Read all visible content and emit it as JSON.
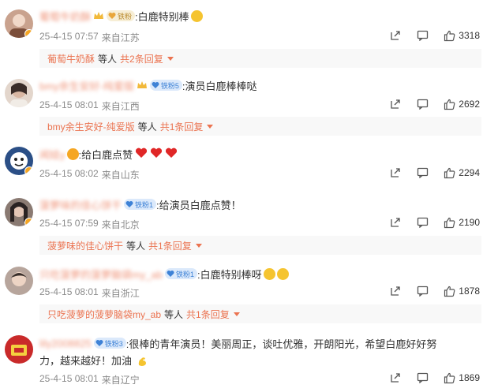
{
  "comments": [
    {
      "user": "葡萄牛奶酥",
      "text": ":白鹿特别棒",
      "time": "25-4-15 07:57",
      "location": "来自江苏",
      "likes": "3318",
      "reply": {
        "user": "葡萄牛奶酥",
        "mid": "等人",
        "count": "共2条回复"
      },
      "avatar_color": "#c9a28e",
      "emoji": "smile-emoji"
    },
    {
      "user": "bmy余生安好-纯爱版",
      "badge": "铁粉5",
      "text": ":演员白鹿棒棒哒",
      "time": "25-4-15 08:01",
      "location": "来自江西",
      "likes": "2692",
      "reply": {
        "user": "bmy余生安好-纯爱版",
        "mid": "等人",
        "count": "共1条回复"
      },
      "avatar_color": "#e3d6cc"
    },
    {
      "user": "闻娃y",
      "text": ":给白鹿点赞",
      "time": "25-4-15 08:02",
      "location": "来自山东",
      "likes": "2294",
      "avatar_color": "#2b4f86"
    },
    {
      "user": "菠萝味的佳心饼干",
      "badge": "铁粉1",
      "text": ":给演员白鹿点赞！",
      "time": "25-4-15 07:59",
      "location": "来自北京",
      "likes": "2190",
      "reply": {
        "user": "菠萝味的佳心饼干",
        "mid": "等人",
        "count": "共1条回复"
      },
      "avatar_color": "#8a7a72"
    },
    {
      "user": "只吃菠萝的菠萝脑袋my_ab",
      "badge": "铁粉1",
      "text": ":白鹿特别棒呀",
      "time": "25-4-15 08:01",
      "location": "来自浙江",
      "likes": "1878",
      "reply": {
        "user": "只吃菠萝的菠萝脑袋my_ab",
        "mid": "等人",
        "count": "共1条回复"
      },
      "avatar_color": "#b7a59c"
    },
    {
      "user": "lily2008825",
      "badge": "铁粉3",
      "text_line1": ":很棒的青年演员！美丽周正，谈吐优雅，开朗阳光，希望白鹿好好努",
      "text_line2": "力，越来越好！加油",
      "time": "25-4-15 08:01",
      "location": "来自辽宁",
      "likes": "1869",
      "avatar_color": "#c92a2a"
    }
  ],
  "icons": {
    "share": "share-icon",
    "comment": "comment-icon",
    "like": "thumbs-up-icon"
  },
  "colors": {
    "accent": "#eb7350",
    "meta": "#8b8b8b",
    "reply_bg": "#f8f8f8"
  }
}
